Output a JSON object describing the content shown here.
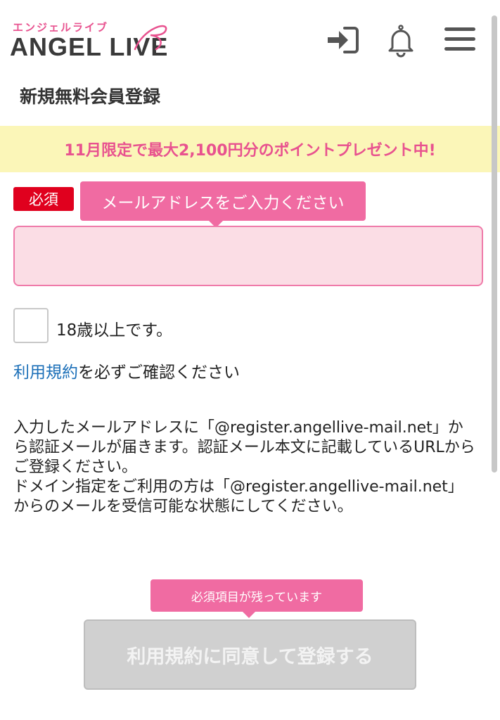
{
  "header": {
    "logo_kana": "エンジェルライブ",
    "logo_text": "ANGEL LIVE",
    "icons": [
      "login-icon",
      "bell-icon",
      "menu-icon"
    ]
  },
  "page_title": "新規無料会員登録",
  "promo": {
    "text": "11月限定で最大2,100円分のポイントプレゼント中!"
  },
  "email_form": {
    "required_label": "必須",
    "tooltip": "メールアドレスをご入力ください",
    "value": ""
  },
  "age_check": {
    "label": "18歳以上です。",
    "checked": false
  },
  "terms": {
    "link_text": "利用規約",
    "suffix": "を必ずご確認ください"
  },
  "notice": {
    "line1": "入力したメールアドレスに「@register.angellive-mail.net」から認証メールが届きます。認証メール本文に記載しているURLからご登録ください。",
    "line2": "ドメイン指定をご利用の方は「@register.angellive-mail.net」からのメールを受信可能な状態にしてください。"
  },
  "submit": {
    "tooltip": "必須項目が残っています",
    "label": "利用規約に同意して登録する",
    "disabled": true
  },
  "colors": {
    "accent_pink": "#f06ba2",
    "promo_bg": "#fbf6b8",
    "required_red": "#e0001e",
    "link_blue": "#1b6fb8"
  }
}
